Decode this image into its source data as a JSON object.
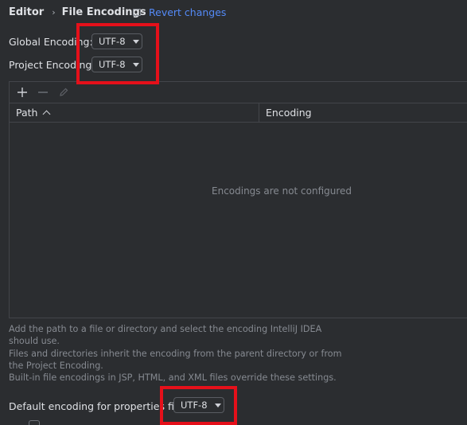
{
  "breadcrumb": {
    "parent": "Editor",
    "current": "File Encodings"
  },
  "revert": {
    "label": "Revert changes"
  },
  "global_encoding": {
    "label": "Global Encoding:",
    "value": "UTF-8"
  },
  "project_encoding": {
    "label": "Project Encoding:",
    "value": "UTF-8"
  },
  "table": {
    "columns": [
      "Path",
      "Encoding"
    ],
    "sort_column": "Path",
    "sort_direction": "ascending",
    "empty_text": "Encodings are not configured"
  },
  "help": {
    "line1": "Add the path to a file or directory and select the encoding IntelliJ IDEA should use.",
    "line2": "Files and directories inherit the encoding from the parent directory or from the Project Encoding.",
    "line3": "Built-in file encodings in JSP, HTML, and XML files override these settings."
  },
  "properties_encoding": {
    "label": "Default encoding for properties files:",
    "value": "UTF-8"
  },
  "colors": {
    "background": "#2b2d30",
    "link": "#548af7",
    "highlight": "#e5101a"
  }
}
